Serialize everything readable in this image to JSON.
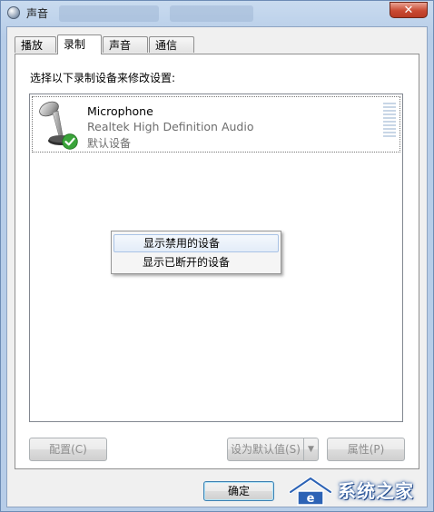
{
  "window": {
    "title": "声音",
    "close_label": "✕"
  },
  "tabs": [
    {
      "label": "播放"
    },
    {
      "label": "录制"
    },
    {
      "label": "声音"
    },
    {
      "label": "通信"
    }
  ],
  "panel": {
    "instruction": "选择以下录制设备来修改设置:"
  },
  "device": {
    "name": "Microphone",
    "driver": "Realtek High Definition Audio",
    "status": "默认设备",
    "icon": "microphone-icon",
    "status_icon": "default-check-icon"
  },
  "context_menu": {
    "items": [
      {
        "label": "显示禁用的设备"
      },
      {
        "label": "显示已断开的设备"
      }
    ]
  },
  "buttons": {
    "configure": "配置(C)",
    "set_default": "设为默认值(S)",
    "properties": "属性(P)",
    "ok": "确定"
  },
  "watermark": {
    "text": "系统之家"
  }
}
